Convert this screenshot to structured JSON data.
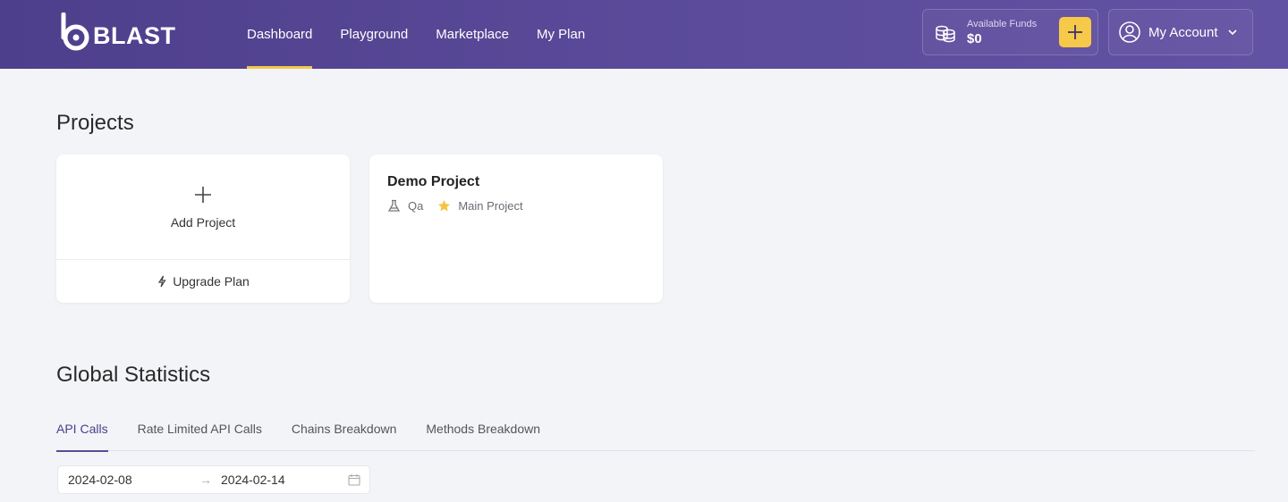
{
  "brand": {
    "name": "BLAST"
  },
  "nav": {
    "items": [
      {
        "label": "Dashboard",
        "active": true
      },
      {
        "label": "Playground",
        "active": false
      },
      {
        "label": "Marketplace",
        "active": false
      },
      {
        "label": "My Plan",
        "active": false
      }
    ]
  },
  "funds": {
    "label": "Available Funds",
    "value": "$0",
    "icon": "coins-icon",
    "add_icon": "plus-icon"
  },
  "account": {
    "label": "My Account",
    "icon": "user-circle-icon",
    "chevron": "chevron-down-icon"
  },
  "projects": {
    "title": "Projects",
    "add_card": {
      "label": "Add Project",
      "upgrade_label": "Upgrade Plan"
    },
    "cards": [
      {
        "title": "Demo Project",
        "tags": [
          {
            "icon": "flask-icon",
            "label": "Qa"
          },
          {
            "icon": "star-icon",
            "label": "Main Project"
          }
        ]
      }
    ]
  },
  "stats": {
    "title": "Global Statistics",
    "tabs": [
      {
        "label": "API Calls",
        "active": true
      },
      {
        "label": "Rate Limited API Calls",
        "active": false
      },
      {
        "label": "Chains Breakdown",
        "active": false
      },
      {
        "label": "Methods Breakdown",
        "active": false
      }
    ],
    "date_range": {
      "start": "2024-02-08",
      "arrow": "→",
      "end": "2024-02-14"
    }
  },
  "colors": {
    "header_start": "#4e3f8c",
    "header_end": "#6252a3",
    "accent_yellow": "#f7c948",
    "active_tab": "#5a4a99",
    "background": "#f3f4f8"
  }
}
